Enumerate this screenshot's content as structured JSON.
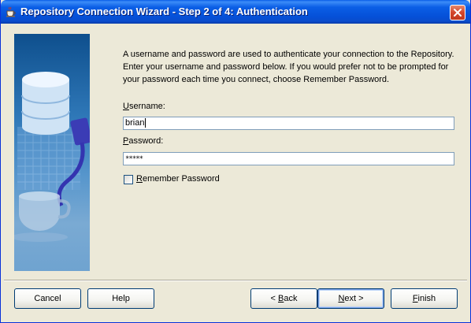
{
  "window": {
    "title": "Repository Connection Wizard - Step 2 of 4: Authentication",
    "icon": "coffee-cup-icon",
    "title_bar_color": "#0550d8",
    "close_button_color": "#d3452b"
  },
  "content": {
    "description": "A username and password are used to authenticate your connection to the Repository. Enter your username and password below. If you would prefer not to be prompted for your password each time you connect, choose Remember Password.",
    "username": {
      "label_first": "U",
      "label_rest": "sername:",
      "value": "brian"
    },
    "password": {
      "label_first": "P",
      "label_rest": "assword:",
      "masked_value": "*****"
    },
    "remember": {
      "label_first": "R",
      "label_rest": "emember Password",
      "checked": false
    }
  },
  "buttons": {
    "cancel": "Cancel",
    "help": "Help",
    "back_first": "< ",
    "back_mnemonic": "B",
    "back_rest": "ack",
    "next_mnemonic": "N",
    "next_rest": "ext >",
    "finish_mnemonic": "F",
    "finish_rest": "inish"
  }
}
